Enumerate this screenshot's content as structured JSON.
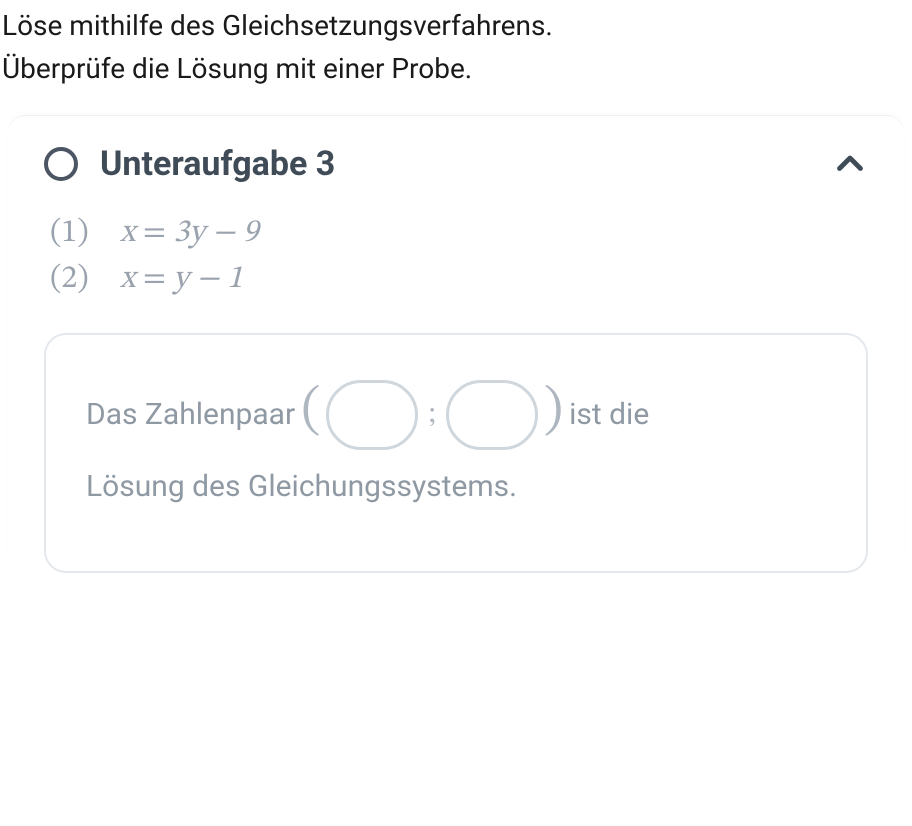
{
  "instructions": {
    "line1": "Löse mithilfe des Gleichsetzungsverfahrens.",
    "line2": "Überprüfe die Lösung mit einer Probe."
  },
  "subtask": {
    "title": "Unteraufgabe 3",
    "expanded": true
  },
  "equations": {
    "eq1": {
      "num": "(1)",
      "lhs": "x",
      "rhs": "3y − 9"
    },
    "eq2": {
      "num": "(2)",
      "lhs": "x",
      "rhs": "y − 1"
    }
  },
  "answer": {
    "prefix": "Das Zahlenpaar",
    "open": "(",
    "sep": ";",
    "close": ")",
    "suffix": "ist die",
    "line2": "Lösung des Gleichungssystems.",
    "blank1": "",
    "blank2": ""
  }
}
